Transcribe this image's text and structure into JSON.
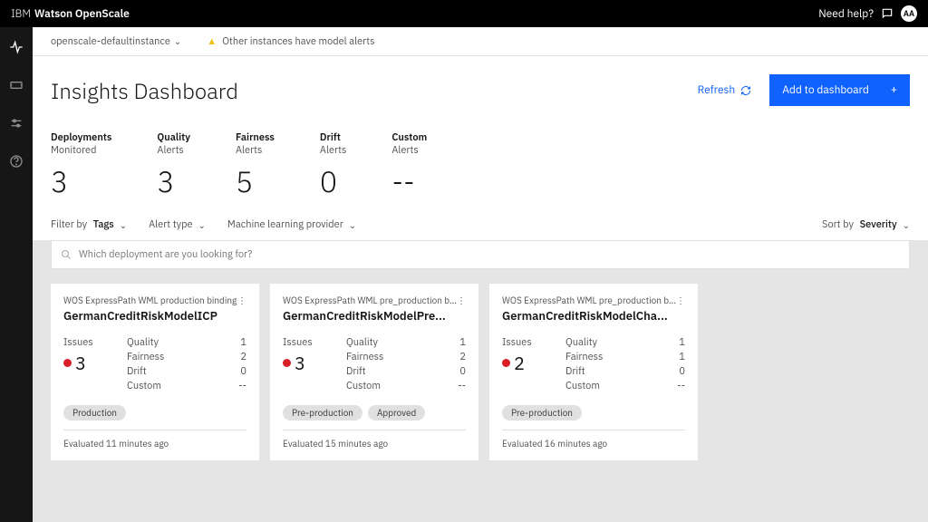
{
  "topbar": {
    "brand_thin": "IBM",
    "brand_bold": "Watson OpenScale",
    "help": "Need help?",
    "avatar": "AA"
  },
  "leftnav": {
    "icons": [
      "activity",
      "ticket",
      "sliders",
      "help"
    ]
  },
  "instance": {
    "name": "openscale-defaultinstance",
    "alert": "Other instances have model alerts"
  },
  "header": {
    "title": "Insights Dashboard",
    "refresh": "Refresh",
    "add": "Add to dashboard"
  },
  "metrics": [
    {
      "label": "Deployments",
      "sub": "Monitored",
      "value": "3"
    },
    {
      "label": "Quality",
      "sub": "Alerts",
      "value": "3"
    },
    {
      "label": "Fairness",
      "sub": "Alerts",
      "value": "5"
    },
    {
      "label": "Drift",
      "sub": "Alerts",
      "value": "0"
    },
    {
      "label": "Custom",
      "sub": "Alerts",
      "value": "--"
    }
  ],
  "filters": {
    "filter_by": "Filter by",
    "tags": "Tags",
    "alert_type": "Alert type",
    "ml_provider": "Machine learning provider",
    "sort_by": "Sort by",
    "severity": "Severity"
  },
  "search": {
    "placeholder": "Which deployment are you looking for?"
  },
  "stat_labels": {
    "issues": "Issues",
    "quality": "Quality",
    "fairness": "Fairness",
    "drift": "Drift",
    "custom": "Custom"
  },
  "cards": [
    {
      "provider": "WOS ExpressPath WML production binding",
      "title": "GermanCreditRiskModelICP",
      "issues": "3",
      "quality": "1",
      "fairness": "2",
      "drift": "0",
      "custom": "--",
      "tags": [
        "Production"
      ],
      "evaluated": "Evaluated 11 minutes ago"
    },
    {
      "provider": "WOS ExpressPath WML pre_production b...",
      "title": "GermanCreditRiskModelPre...",
      "issues": "3",
      "quality": "1",
      "fairness": "2",
      "drift": "0",
      "custom": "--",
      "tags": [
        "Pre-production",
        "Approved"
      ],
      "evaluated": "Evaluated 15 minutes ago"
    },
    {
      "provider": "WOS ExpressPath WML pre_production b...",
      "title": "GermanCreditRiskModelCha...",
      "issues": "2",
      "quality": "1",
      "fairness": "1",
      "drift": "0",
      "custom": "--",
      "tags": [
        "Pre-production"
      ],
      "evaluated": "Evaluated 16 minutes ago"
    }
  ]
}
